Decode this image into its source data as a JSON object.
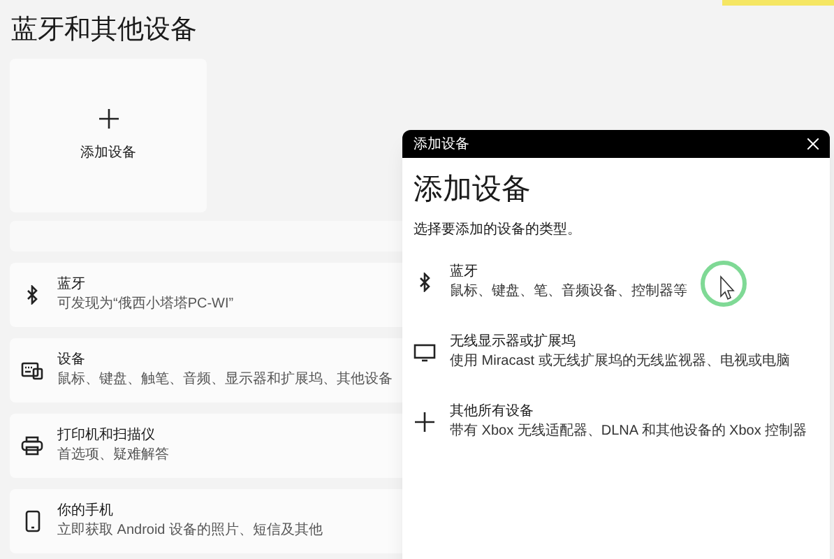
{
  "page": {
    "title": "蓝牙和其他设备",
    "add_tile": {
      "label": "添加设备"
    }
  },
  "settings_rows": [
    {
      "kind": "bluetooth",
      "title": "蓝牙",
      "subtitle": "可发现为“俄西小塔塔PC-WI”"
    },
    {
      "kind": "devices",
      "title": "设备",
      "subtitle": "鼠标、键盘、触笔、音频、显示器和扩展坞、其他设备"
    },
    {
      "kind": "printer",
      "title": "打印机和扫描仪",
      "subtitle": "首选项、疑难解答"
    },
    {
      "kind": "phone",
      "title": "你的手机",
      "subtitle": "立即获取 Android 设备的照片、短信及其他"
    }
  ],
  "dialog": {
    "title": "添加设备",
    "heading": "添加设备",
    "prompt": "选择要添加的设备的类型。",
    "options": [
      {
        "kind": "bluetooth",
        "title": "蓝牙",
        "subtitle": "鼠标、键盘、笔、音频设备、控制器等"
      },
      {
        "kind": "display",
        "title": "无线显示器或扩展坞",
        "subtitle": "使用 Miracast 或无线扩展坞的无线监视器、电视或电脑"
      },
      {
        "kind": "other",
        "title": "其他所有设备",
        "subtitle": "带有 Xbox 无线适配器、DLNA 和其他设备的 Xbox 控制器"
      }
    ]
  }
}
